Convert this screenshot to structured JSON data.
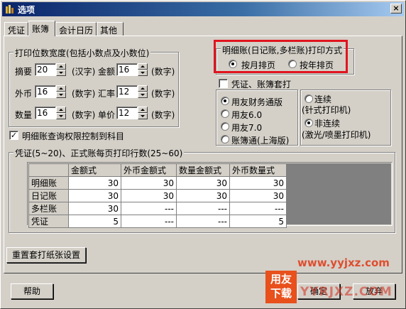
{
  "window": {
    "title": "选项",
    "close_label": "×"
  },
  "tabs": [
    {
      "label": "凭证"
    },
    {
      "label": "账簿"
    },
    {
      "label": "会计日历"
    },
    {
      "label": "其他"
    }
  ],
  "print_digits": {
    "legend": "打印位数宽度(包括小数点及小数位)",
    "rows": [
      {
        "label": "摘要",
        "value": "20",
        "unit": "(汉字)",
        "label2": "金额",
        "value2": "16",
        "unit2": "(数字)"
      },
      {
        "label": "外币",
        "value": "16",
        "unit": "(数字)",
        "label2": "汇率",
        "value2": "12",
        "unit2": "(数字)"
      },
      {
        "label": "数量",
        "value": "16",
        "unit": "(数字)",
        "label2": "单价",
        "value2": "12",
        "unit2": "(数字)"
      }
    ]
  },
  "print_mode": {
    "legend": "明细账(日记账,多栏账)打印方式",
    "options": [
      {
        "label": "按月排页",
        "checked": true
      },
      {
        "label": "按年排页",
        "checked": false
      }
    ]
  },
  "voucher_set": {
    "legend": "凭证、账簿套打",
    "checked": false,
    "left_options": [
      {
        "label": "用友财务通版",
        "checked": true
      },
      {
        "label": "用友6.0",
        "checked": false
      },
      {
        "label": "用友7.0",
        "checked": false
      },
      {
        "label": "账簿通(上海版)",
        "checked": false
      }
    ],
    "right_options": [
      {
        "label": "连续",
        "sub": "(针式打印机)",
        "checked": false
      },
      {
        "label": "非连续",
        "sub": "(激光/喷墨打印机)",
        "checked": true
      }
    ]
  },
  "ledger_permission": {
    "label": "明细账查询权限控制到科目",
    "checked": true
  },
  "rows_per_page": {
    "legend": "凭证(5~20)、正式账每页打印行数(25~60)",
    "columns": [
      "",
      "金额式",
      "外币金额式",
      "数量金额式",
      "外币数量式"
    ],
    "rows": [
      {
        "name": "明细账",
        "cells": [
          "30",
          "30",
          "30",
          "30"
        ]
      },
      {
        "name": "日记账",
        "cells": [
          "30",
          "30",
          "30",
          "30"
        ]
      },
      {
        "name": "多栏账",
        "cells": [
          "30",
          "---",
          "---",
          "---"
        ]
      },
      {
        "name": "凭证",
        "cells": [
          "5",
          "---",
          "---",
          "5"
        ]
      }
    ]
  },
  "buttons": {
    "reset": "重置套打纸张设置",
    "help": "帮助",
    "ok": "确定",
    "cancel": "放弃"
  },
  "watermark": {
    "site": "www.yyjxz.com",
    "logo_top": "用友",
    "logo_bottom": "下载",
    "domain": "YYRJXZ.COM"
  },
  "colors": {
    "highlight": "#e0141e",
    "titlebar": "#0a246a",
    "watermark": "#e04020"
  }
}
